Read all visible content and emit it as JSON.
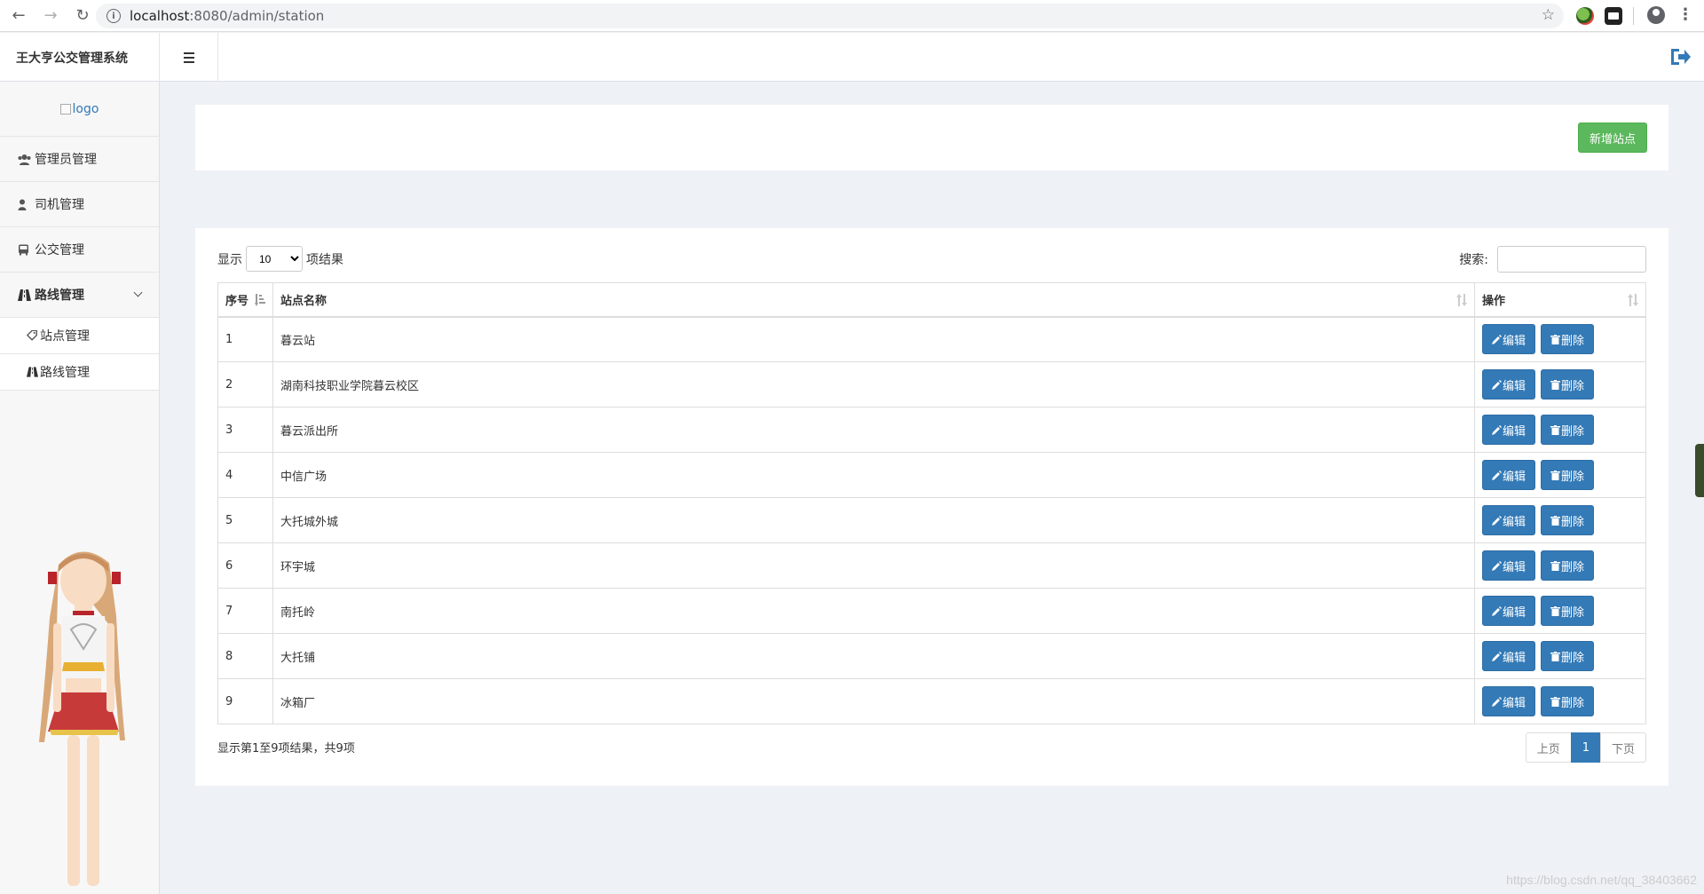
{
  "browser": {
    "url_host": "localhost",
    "url_path": ":8080/admin/station"
  },
  "app": {
    "title": "王大亨公交管理系统",
    "logo_alt": "logo"
  },
  "sidebar": {
    "items": [
      {
        "label": "管理员管理",
        "icon": "users-icon"
      },
      {
        "label": "司机管理",
        "icon": "user-icon"
      },
      {
        "label": "公交管理",
        "icon": "bus-icon"
      },
      {
        "label": "路线管理",
        "icon": "road-icon"
      }
    ],
    "sub_items": [
      {
        "label": "站点管理",
        "icon": "tag-icon"
      },
      {
        "label": "路线管理",
        "icon": "road-icon"
      }
    ]
  },
  "toolbar": {
    "add_label": "新增站点"
  },
  "table_controls": {
    "show_prefix": "显示",
    "page_length": "10",
    "show_suffix": "项结果",
    "search_label": "搜索:",
    "search_value": ""
  },
  "table": {
    "headers": [
      "序号",
      "站点名称",
      "操作"
    ],
    "edit_label": "编辑",
    "delete_label": "删除",
    "rows": [
      {
        "id": "1",
        "name": "暮云站"
      },
      {
        "id": "2",
        "name": "湖南科技职业学院暮云校区"
      },
      {
        "id": "3",
        "name": "暮云派出所"
      },
      {
        "id": "4",
        "name": "中信广场"
      },
      {
        "id": "5",
        "name": "大托城外城"
      },
      {
        "id": "6",
        "name": "环宇城"
      },
      {
        "id": "7",
        "name": "南托岭"
      },
      {
        "id": "8",
        "name": "大托铺"
      },
      {
        "id": "9",
        "name": "冰箱厂"
      }
    ]
  },
  "footer": {
    "info": "显示第1至9项结果，共9项",
    "prev": "上页",
    "page": "1",
    "next": "下页"
  },
  "watermark": "https://blog.csdn.net/qq_38403662",
  "colors": {
    "primary": "#337ab7",
    "success": "#5cb85c"
  }
}
